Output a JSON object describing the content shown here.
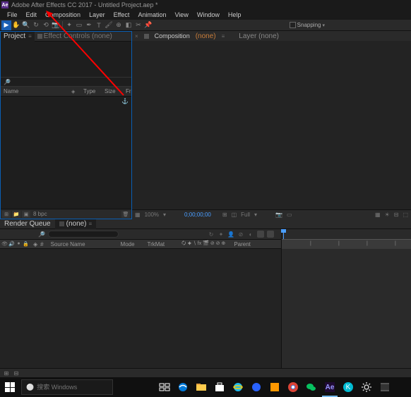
{
  "title_bar": {
    "app_name": "Adobe After Effects CC 2017 - Untitled Project.aep *",
    "app_icon_text": "Ae"
  },
  "menu": {
    "items": [
      "File",
      "Edit",
      "Composition",
      "Layer",
      "Effect",
      "Animation",
      "View",
      "Window",
      "Help"
    ]
  },
  "toolbar": {
    "snapping_label": "Snapping"
  },
  "project_panel": {
    "tab_label": "Project",
    "effect_controls_label": "Effect Controls (none)",
    "columns": {
      "name": "Name",
      "type": "Type",
      "size": "Size",
      "fr": "Fr"
    },
    "bpc_label": "8 bpc"
  },
  "comp_panel": {
    "comp_label": "Composition",
    "none_label": "(none)",
    "layer_label": "Layer (none)",
    "zoom": "100%",
    "time": "0;00;00;00",
    "full": "Full"
  },
  "timeline": {
    "render_queue_label": "Render Queue",
    "none_tab": "(none)",
    "columns": {
      "source_name": "Source Name",
      "mode": "Mode",
      "trkmat": "TrkMat",
      "parent": "Parent"
    },
    "switches_hint": "🗘 ✦ ∖ fx 🎬 ⊘ ⊘ ⊕"
  },
  "taskbar": {
    "search_placeholder": "搜索 Windows"
  }
}
